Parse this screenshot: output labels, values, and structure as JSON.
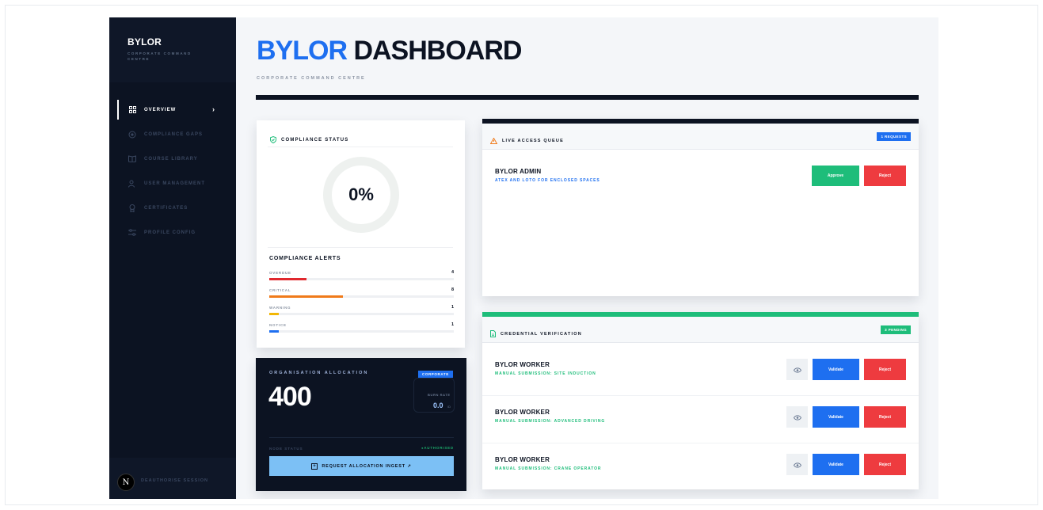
{
  "sidebar": {
    "brand": "BYLOR",
    "brand_subtitle": "CORPORATE COMMAND CENTRE",
    "items": [
      {
        "label": "OVERVIEW",
        "icon": "grid-icon",
        "active": true
      },
      {
        "label": "COMPLIANCE GAPS",
        "icon": "target-icon"
      },
      {
        "label": "COURSE LIBRARY",
        "icon": "book-icon"
      },
      {
        "label": "USER MANAGEMENT",
        "icon": "user-icon"
      },
      {
        "label": "CERTIFICATES",
        "icon": "award-icon"
      },
      {
        "label": "PROFILE CONFIG",
        "icon": "sliders-icon"
      }
    ],
    "avatar_letter": "N",
    "signout": "DEAUTHORISE SESSION"
  },
  "header": {
    "title_part1": "BYLOR",
    "title_part2": "DASHBOARD",
    "subtitle": "CORPORATE COMMAND CENTRE"
  },
  "compliance": {
    "title": "COMPLIANCE STATUS",
    "percent": "0%",
    "alerts_title": "COMPLIANCE ALERTS",
    "alerts": [
      {
        "label": "OVERDUE",
        "count": "4",
        "level": 0.2,
        "color": "#e0282e"
      },
      {
        "label": "CRITICAL",
        "count": "8",
        "level": 0.4,
        "color": "#f07a1a"
      },
      {
        "label": "WARNING",
        "count": "1",
        "level": 0.05,
        "color": "#f2b705"
      },
      {
        "label": "NOTICE",
        "count": "1",
        "level": 0.05,
        "color": "#1e6ff0"
      }
    ]
  },
  "allocation": {
    "title": "ORGANISATION ALLOCATION",
    "value": "400",
    "badge": "CORPORATE",
    "burn_label": "BURN RATE",
    "burn_value": "0.0",
    "burn_unit": "/D",
    "node_label": "NODE STATUS",
    "node_value": "AUTHORISED",
    "button": "REQUEST ALLOCATION INGEST ↗"
  },
  "queue": {
    "title": "LIVE ACCESS QUEUE",
    "badge": "1 REQUESTS",
    "requests": [
      {
        "name": "BYLOR ADMIN",
        "detail": "ATEX AND LOTO FOR ENCLOSED SPACES",
        "approve": "Approve",
        "reject": "Reject"
      }
    ]
  },
  "credentials": {
    "title": "CREDENTIAL VERIFICATION",
    "badge": "3 PENDING",
    "rows": [
      {
        "name": "BYLOR WORKER",
        "detail": "MANUAL SUBMISSION: SITE INDUCTION",
        "validate": "Validate",
        "reject": "Reject"
      },
      {
        "name": "BYLOR WORKER",
        "detail": "MANUAL SUBMISSION: ADVANCED DRIVING",
        "validate": "Validate",
        "reject": "Reject"
      },
      {
        "name": "BYLOR WORKER",
        "detail": "MANUAL SUBMISSION: CRANE OPERATOR",
        "validate": "Validate",
        "reject": "Reject"
      }
    ]
  },
  "colors": {
    "brand_blue": "#1e6ff0",
    "navy": "#0c1322",
    "green": "#1ebd7a",
    "red": "#ee3b3f",
    "orange_icon": "#f07a1a"
  }
}
